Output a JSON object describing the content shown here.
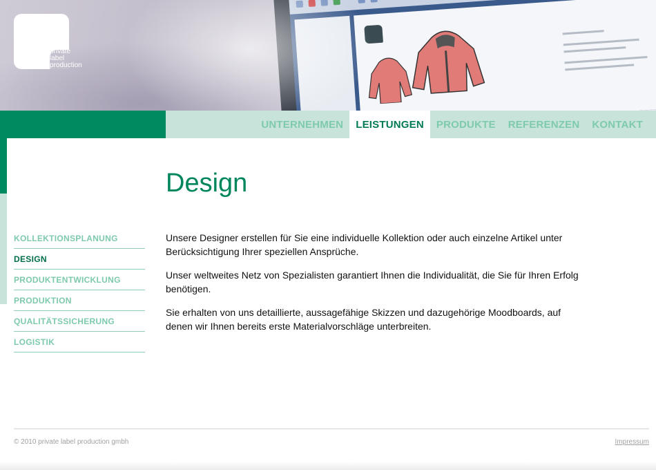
{
  "logo": {
    "line1": "private",
    "line2": "label",
    "line3": "production"
  },
  "nav": {
    "items": [
      {
        "label": "UNTERNEHMEN"
      },
      {
        "label": "LEISTUNGEN"
      },
      {
        "label": "PRODUKTE"
      },
      {
        "label": "REFERENZEN"
      },
      {
        "label": "KONTAKT"
      }
    ],
    "active": "LEISTUNGEN"
  },
  "page": {
    "title": "Design"
  },
  "sidebar": {
    "items": [
      {
        "label": "KOLLEKTIONSPLANUNG"
      },
      {
        "label": "DESIGN"
      },
      {
        "label": "PRODUKTENTWICKLUNG"
      },
      {
        "label": "PRODUKTION"
      },
      {
        "label": "QUALITÄTSSICHERUNG"
      },
      {
        "label": "LOGISTIK"
      }
    ],
    "active": "DESIGN"
  },
  "content": {
    "paragraphs": [
      "Unsere Designer erstellen für Sie eine individuelle Kollektion oder auch einzelne Artikel unter Berücksichtigung Ihrer speziellen Ansprüche.",
      "Unser weltweites Netz von Spezialisten garantiert Ihnen die Individualität, die Sie für Ihren Erfolg benötigen.",
      "Sie erhalten von uns detaillierte, aussagefähige Skizzen und dazugehörige Moodboards, auf denen wir Ihnen bereits erste Materialvorschläge unterbreiten."
    ]
  },
  "footer": {
    "copyright": "© 2010 private label production gmbh",
    "impressum": "Impressum"
  },
  "colors": {
    "brand_green": "#008a5f",
    "light_green": "#c8e4da",
    "nav_text": "#7ecaac"
  }
}
